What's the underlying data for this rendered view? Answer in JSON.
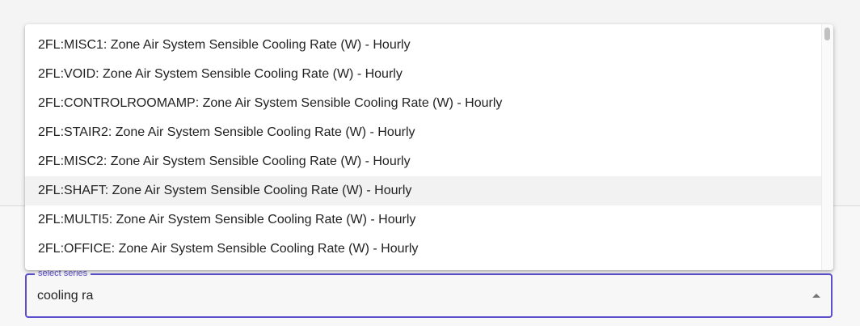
{
  "select": {
    "label": "select series",
    "value": "cooling ra"
  },
  "options": [
    "2FL:MISC1: Zone Air System Sensible Cooling Rate (W) - Hourly",
    "2FL:VOID: Zone Air System Sensible Cooling Rate (W) - Hourly",
    "2FL:CONTROLROOMAMP: Zone Air System Sensible Cooling Rate (W) - Hourly",
    "2FL:STAIR2: Zone Air System Sensible Cooling Rate (W) - Hourly",
    "2FL:MISC2: Zone Air System Sensible Cooling Rate (W) - Hourly",
    "2FL:SHAFT: Zone Air System Sensible Cooling Rate (W) - Hourly",
    "2FL:MULTI5: Zone Air System Sensible Cooling Rate (W) - Hourly",
    "2FL:OFFICE: Zone Air System Sensible Cooling Rate (W) - Hourly"
  ],
  "highlighted_option": "2FL:SHAFT: Zone Air System Sensible Cooling Rate (W) - Hourly",
  "colors": {
    "accent": "#5b4fcf",
    "highlight": "#f2f2f2"
  },
  "icons": {
    "dropdown": "triangle-up-icon"
  }
}
